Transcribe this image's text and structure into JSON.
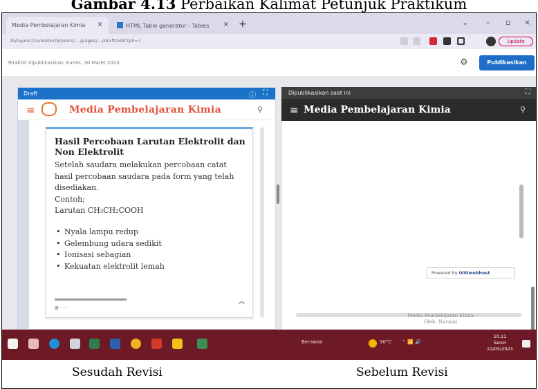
{
  "figure": {
    "number_label": "Gambar 4.13",
    "caption_text": "Perbaikan Kalimat Petunjuk Praktikum",
    "left_label": "Sesudah Revisi",
    "right_label": "Sebelum Revisi"
  },
  "browser": {
    "tabs": [
      {
        "label": "Media Pembelajaran Kimia"
      },
      {
        "label": "HTML Table generator - Tables"
      }
    ],
    "update_label": "Update"
  },
  "editor": {
    "pub_info": "Terakhir dipublikasikan: Kamis, 30 Maret 2023",
    "publish_button": "Publikasikan"
  },
  "left_panel": {
    "status": "Draft",
    "app_title": "Media Pembelajaran Kimia",
    "card": {
      "heading": "Hasil Percobaan Larutan Elektrolit dan Non Elektrolit",
      "paragraph": "Setelah saudara melakukan percobaan catat hasil percobaan saudara pada form yang telah disediakan.",
      "example_label": "Contoh;",
      "solution": "Larutan CH₃CH₂COOH",
      "bullets": [
        "Nyala lampu redup",
        "Gelembung udara sedikit",
        "Ionisasi sebagian",
        "Kekuatan elektrolit lemah"
      ]
    }
  },
  "right_panel": {
    "status": "Dipublikasikan saat ini",
    "app_title": "Media Pembelajaran Kimia",
    "powered_by": "Powered by",
    "powered_brand": "000webhost",
    "footer_line1": "Media Pembelajaran Kimia",
    "footer_line2": "Oleh: Nuraini"
  },
  "taskbar": {
    "weather": "Berawan",
    "temperature": "30°C",
    "time": "10.11",
    "day": "Senin",
    "date": "22/05/2023"
  },
  "colors": {
    "accent_blue": "#1a73c9",
    "title_orange": "#e2523a",
    "taskbar": "#6e1a26",
    "right_header": "#2b2b2b"
  }
}
